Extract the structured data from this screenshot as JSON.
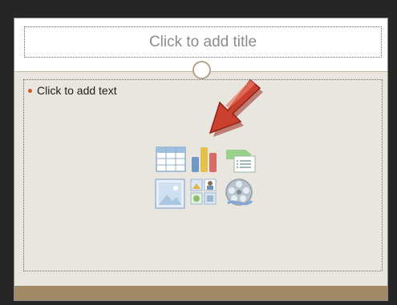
{
  "slide": {
    "title_placeholder": "Click to add title",
    "body_placeholder": "Click to add text",
    "bullet_color": "#d45a1c"
  },
  "content_icons": [
    {
      "name": "insert-table-icon"
    },
    {
      "name": "insert-chart-icon"
    },
    {
      "name": "insert-smartart-icon"
    },
    {
      "name": "insert-picture-icon"
    },
    {
      "name": "insert-clip-art-icon"
    },
    {
      "name": "insert-media-icon"
    }
  ],
  "annotation": {
    "arrow": "red-pointer-arrow-icon",
    "color": "#c0392b"
  }
}
